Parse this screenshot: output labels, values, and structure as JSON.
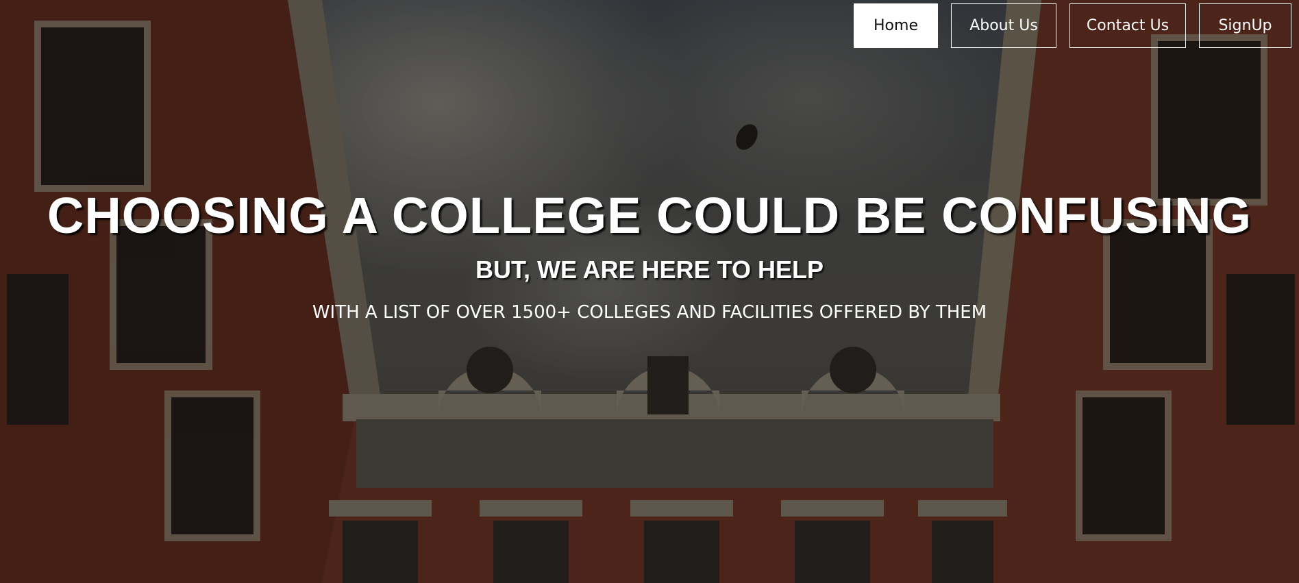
{
  "nav": {
    "items": [
      {
        "label": "Home",
        "active": true
      },
      {
        "label": "About Us",
        "active": false
      },
      {
        "label": "Contact Us",
        "active": false
      },
      {
        "label": "SignUp",
        "active": false
      }
    ]
  },
  "hero": {
    "headline": "CHOOSING A COLLEGE COULD BE CONFUSING",
    "subhead": "BUT, WE ARE HERE TO HELP",
    "tagline": "WITH A LIST OF OVER 1500+ COLLEGES AND FACILITIES OFFERED BY THEM"
  },
  "colors": {
    "nav_active_bg": "#ffffff",
    "nav_border": "#ffffff",
    "brick": "#8a3f2a",
    "stone": "#b6aa95"
  }
}
